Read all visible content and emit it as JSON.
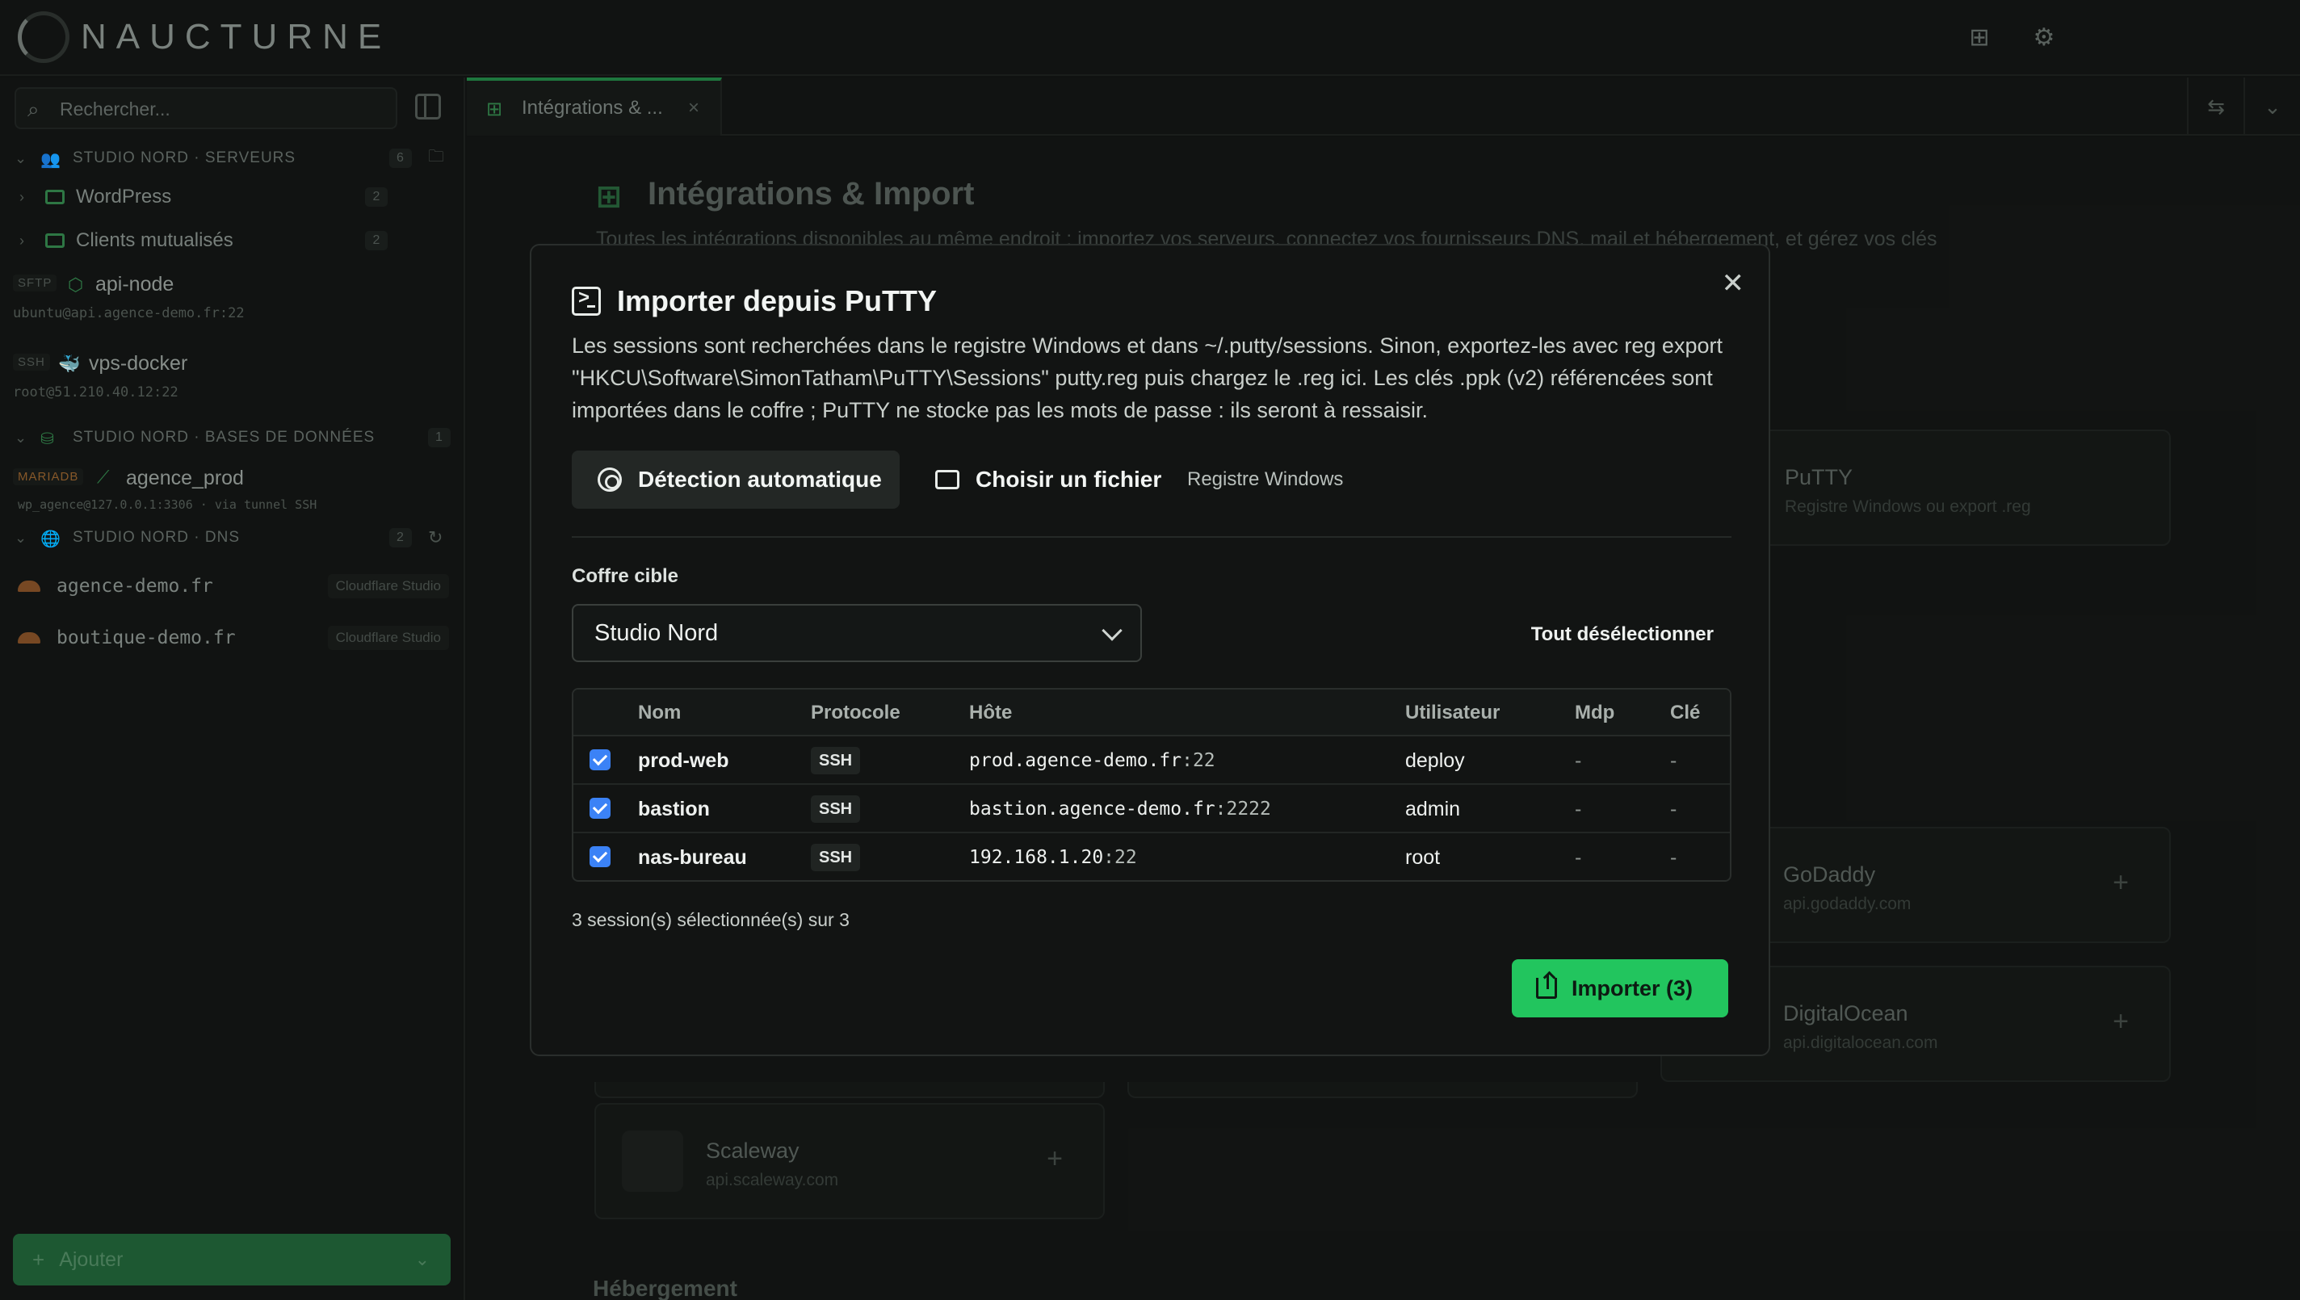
{
  "app": {
    "logo_text": "NAUCTURNE"
  },
  "topbar": {
    "icon_integrations": "integrations-icon",
    "icon_settings": "gear-icon"
  },
  "sidebar": {
    "search_placeholder": "Rechercher...",
    "groups": [
      {
        "title": "STUDIO NORD · SERVEURS",
        "count": "6"
      },
      {
        "title": "STUDIO NORD · BASES DE DONNÉES",
        "count": "1"
      },
      {
        "title": "STUDIO NORD · DNS",
        "count": "2"
      }
    ],
    "folders": [
      {
        "name": "WordPress",
        "count": "2"
      },
      {
        "name": "Clients mutualisés",
        "count": "2"
      }
    ],
    "servers": [
      {
        "tag": "SFTP",
        "name": "api-node",
        "sub": "ubuntu@api.agence-demo.fr:22"
      },
      {
        "tag": "SSH",
        "name": "vps-docker",
        "sub": "root@51.210.40.12:22"
      }
    ],
    "database": {
      "tag": "MARIADB",
      "name": "agence_prod",
      "sub": "wp_agence@127.0.0.1:3306 · via tunnel SSH"
    },
    "dns": [
      {
        "name": "agence-demo.fr",
        "provider": "Cloudflare Studio"
      },
      {
        "name": "boutique-demo.fr",
        "provider": "Cloudflare Studio"
      }
    ],
    "add_label": "Ajouter"
  },
  "tabs": [
    {
      "label": "Intégrations & ..."
    }
  ],
  "main": {
    "title": "Intégrations & Import",
    "description": "Toutes les intégrations disponibles au même endroit : importez vos serveurs, connectez vos fournisseurs DNS, mail et hébergement, et gérez vos clés",
    "cards": [
      {
        "name": "PuTTY",
        "sub": "Registre Windows ou export .reg"
      },
      {
        "name": "GoDaddy",
        "sub": "api.godaddy.com"
      },
      {
        "name": "DigitalOcean",
        "sub": "api.digitalocean.com"
      },
      {
        "name": "Scaleway",
        "sub": "api.scaleway.com"
      }
    ],
    "section_hosting": "Hébergement"
  },
  "modal": {
    "title": "Importer depuis PuTTY",
    "description": "Les sessions sont recherchées dans le registre Windows et dans ~/.putty/sessions. Sinon, exportez-les avec reg export \"HKCU\\Software\\SimonTatham\\PuTTY\\Sessions\" putty.reg puis chargez le .reg ici. Les clés .ppk (v2) référencées sont importées dans le coffre ; PuTTY ne stocke pas les mots de passe : ils seront à ressaisir.",
    "mode_auto": "Détection automatique",
    "mode_file": "Choisir un fichier",
    "mode_registry": "Registre Windows",
    "vault_label": "Coffre cible",
    "vault_value": "Studio Nord",
    "deselect_all": "Tout désélectionner",
    "columns": [
      "Nom",
      "Protocole",
      "Hôte",
      "Utilisateur",
      "Mdp",
      "Clé"
    ],
    "rows": [
      {
        "name": "prod-web",
        "protocol": "SSH",
        "host": "prod.agence-demo.fr",
        "port": ":22",
        "user": "deploy",
        "pwd": "-",
        "key": "-"
      },
      {
        "name": "bastion",
        "protocol": "SSH",
        "host": "bastion.agence-demo.fr",
        "port": ":2222",
        "user": "admin",
        "pwd": "-",
        "key": "-"
      },
      {
        "name": "nas-bureau",
        "protocol": "SSH",
        "host": "192.168.1.20",
        "port": ":22",
        "user": "root",
        "pwd": "-",
        "key": "-"
      }
    ],
    "selection_status": "3 session(s) sélectionnée(s) sur 3",
    "import_label": "Importer (3)"
  },
  "colors": {
    "accent": "#22c55e",
    "checkbox": "#3b82f6",
    "background": "#121413"
  }
}
